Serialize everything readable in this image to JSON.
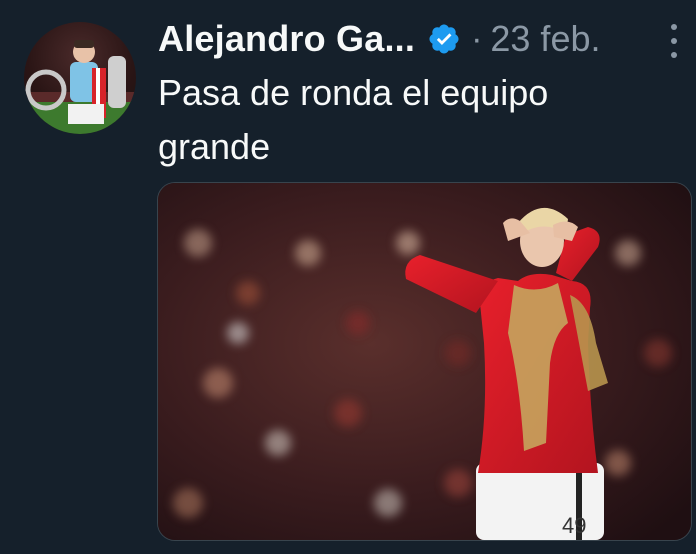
{
  "tweet": {
    "author": "Alejandro Ga...",
    "separator": "·",
    "date": "23 feb.",
    "text": "Pasa de ronda el equipo grande",
    "icons": {
      "verified": "verified-badge-icon",
      "more": "more-options-icon"
    },
    "media": {
      "shirt_number": "49"
    }
  },
  "colors": {
    "background": "#15202b",
    "primary_text": "#f7f9f9",
    "secondary_text": "#8b98a5",
    "verified_blue": "#1d9bf0"
  }
}
